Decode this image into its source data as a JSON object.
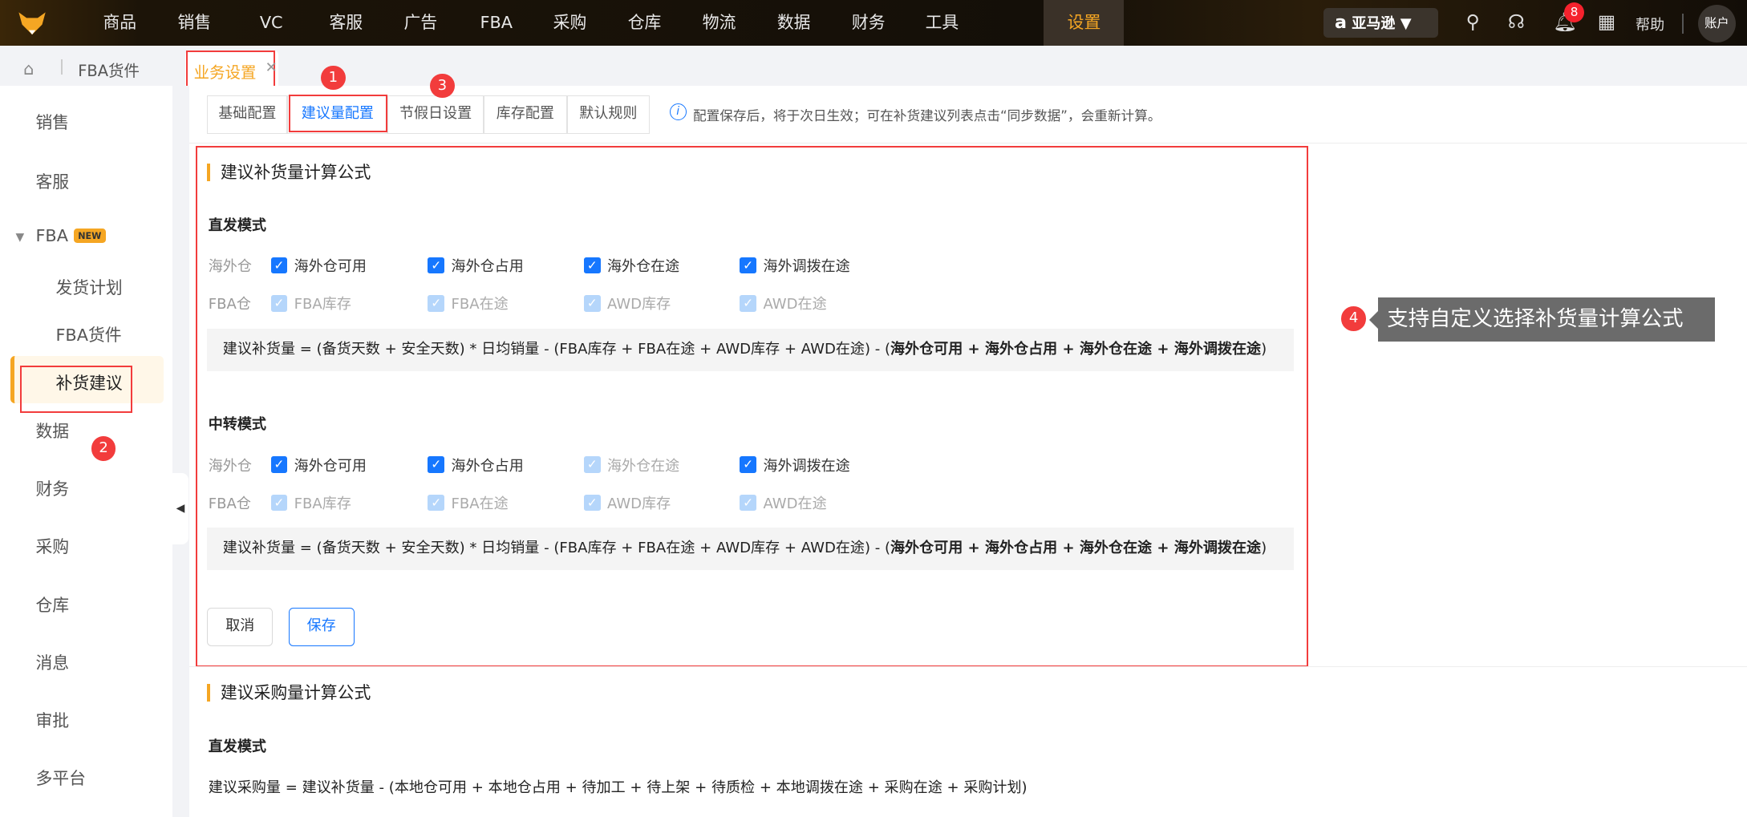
{
  "topnav": {
    "items": [
      "商品",
      "销售",
      "VC",
      "客服",
      "广告",
      "FBA",
      "采购",
      "仓库",
      "物流",
      "数据",
      "财务",
      "工具",
      "设置"
    ],
    "active": "设置",
    "marketplace": "亚马逊",
    "notifications": "8",
    "help": "帮助",
    "account": "账户"
  },
  "breadcrumb": {
    "home": "FBA货件",
    "tab": "业务设置"
  },
  "sidebar": {
    "items": [
      "销售",
      "客服"
    ],
    "fba": "FBA",
    "fba_badge": "NEW",
    "fba_sub": [
      "发货计划",
      "FBA货件",
      "补货建议"
    ],
    "items2": [
      "数据",
      "财务",
      "采购",
      "仓库",
      "消息",
      "审批",
      "多平台"
    ]
  },
  "tabs": [
    "基础配置",
    "建议量配置",
    "节假日设置",
    "库存配置",
    "默认规则"
  ],
  "info": "配置保存后，将于次日生效；可在补货建议列表点击“同步数据”，会重新计算。",
  "replenish": {
    "title": "建议补货量计算公式",
    "direct": {
      "mode": "直发模式",
      "overseas_label": "海外仓",
      "overseas": [
        "海外仓可用",
        "海外仓占用",
        "海外仓在途",
        "海外调拨在途"
      ],
      "fba_label": "FBA仓",
      "fba": [
        "FBA库存",
        "FBA在途",
        "AWD库存",
        "AWD在途"
      ],
      "formula_a": "建议补货量 = (备货天数 + 安全天数) * 日均销量 - (FBA库存 + FBA在途 + AWD库存 + AWD在途) - (",
      "formula_b": "海外仓可用 + 海外仓占用 + 海外仓在途 + 海外调拨在途",
      "formula_c": ")"
    },
    "transfer": {
      "mode": "中转模式",
      "overseas_label": "海外仓",
      "overseas": [
        "海外仓可用",
        "海外仓占用",
        "海外仓在途",
        "海外调拨在途"
      ],
      "fba_label": "FBA仓",
      "fba": [
        "FBA库存",
        "FBA在途",
        "AWD库存",
        "AWD在途"
      ],
      "formula_a": "建议补货量 = (备货天数 + 安全天数) * 日均销量 - (FBA库存 + FBA在途 + AWD库存 + AWD在途) - (",
      "formula_b": "海外仓可用 + 海外仓占用 + 海外仓在途 + 海外调拨在途",
      "formula_c": ")"
    },
    "cancel": "取消",
    "save": "保存"
  },
  "purchase": {
    "title": "建议采购量计算公式",
    "mode": "直发模式",
    "formula": "建议采购量 = 建议补货量 - (本地仓可用 + 本地仓占用 + 待加工 + 待上架 + 待质检 + 本地调拨在途 + 采购在途 + 采购计划)"
  },
  "annotations": {
    "n1": "1",
    "n2": "2",
    "n3": "3",
    "n4": "4",
    "tip": "支持自定义选择补货量计算公式"
  },
  "colors": {
    "accent": "#f5a623",
    "primary": "#1677ff",
    "highlight": "#f23c3c"
  }
}
